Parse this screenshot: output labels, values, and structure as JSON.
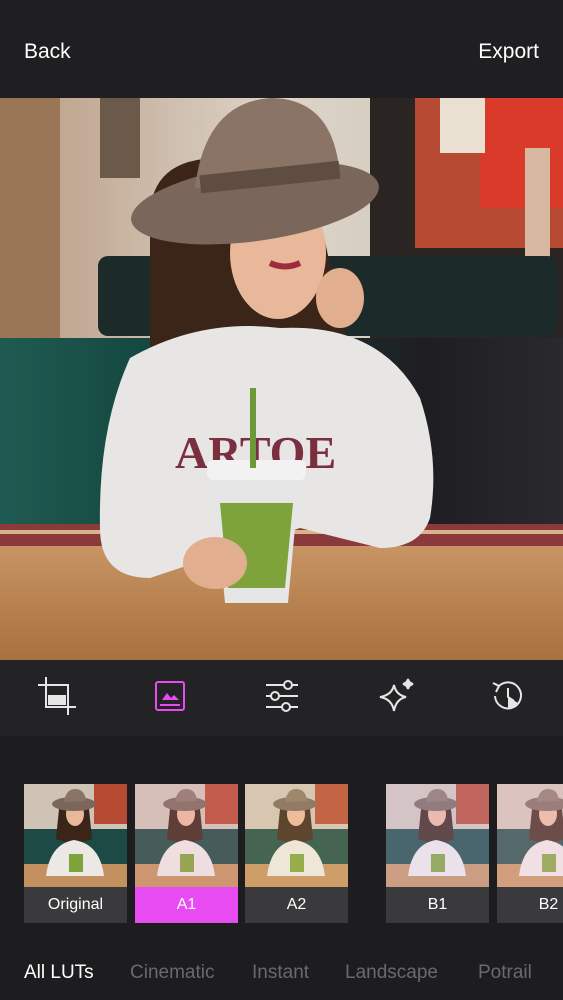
{
  "header": {
    "back_label": "Back",
    "export_label": "Export"
  },
  "toolbar": {
    "tools": [
      {
        "name": "crop",
        "icon": "crop-icon"
      },
      {
        "name": "filters",
        "icon": "image-filter-icon",
        "active": true
      },
      {
        "name": "adjust",
        "icon": "sliders-icon"
      },
      {
        "name": "effects",
        "icon": "sparkle-icon"
      },
      {
        "name": "history",
        "icon": "history-icon"
      }
    ],
    "accent": "#e84bf2"
  },
  "presets": {
    "items": [
      {
        "label": "Original"
      },
      {
        "label": "A1",
        "selected": true
      },
      {
        "label": "A2"
      },
      {
        "label": "B1"
      },
      {
        "label": "B2"
      }
    ]
  },
  "categories": {
    "tabs": [
      {
        "label": "All LUTs",
        "active": true
      },
      {
        "label": "Cinematic"
      },
      {
        "label": "Instant"
      },
      {
        "label": "Landscape"
      },
      {
        "label": "Potrail"
      }
    ]
  }
}
